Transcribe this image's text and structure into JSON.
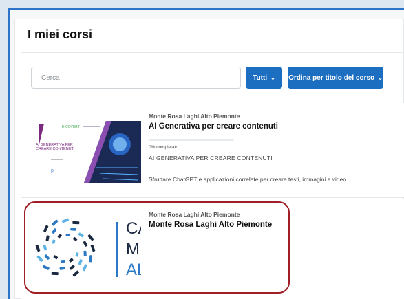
{
  "page": {
    "title": "I miei corsi"
  },
  "search": {
    "placeholder": "Cerca"
  },
  "filters": {
    "all_label": "Tutti",
    "sort_label": "Ordina per titolo del corso"
  },
  "courses": [
    {
      "category": "Monte Rosa Laghi Alto Piemonte",
      "name": "AI Generativa per creare contenuti",
      "progress_text": "0% completato",
      "progress_percent": 0,
      "short_name": "AI GENERATIVA PER CREARE CONTENUTI",
      "summary": "Sfruttare ChatGPT e applicazioni correlate per creare testi, immagini e video",
      "thumbnail": {
        "brand": "E-COVERT",
        "text": "AI GENERATIVA PER CREARE CONTENUTI",
        "footer": "pl",
        "icon": "brain-circuit-icon"
      }
    },
    {
      "category": "Monte Rosa Laghi Alto Piemonte",
      "name": "Monte Rosa Laghi Alto Piemonte",
      "thumbnail": {
        "line1": "CA",
        "line2": "M",
        "line3": "AL",
        "icon": "swirl-logo-icon"
      }
    }
  ],
  "colors": {
    "accent": "#1c6ec1",
    "highlight_border": "#a11e26",
    "frame_border": "#2b74c7"
  }
}
